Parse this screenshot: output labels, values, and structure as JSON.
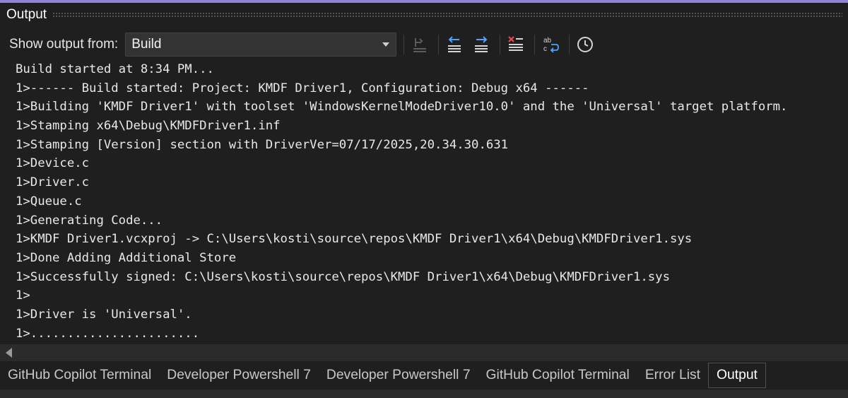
{
  "panel": {
    "title": "Output"
  },
  "toolbar": {
    "show_label": "Show output from:",
    "source_selected": "Build",
    "buttons": [
      {
        "name": "find-message-in-code-icon",
        "enabled": false
      },
      {
        "name": "go-to-previous-message-icon",
        "enabled": true
      },
      {
        "name": "go-to-next-message-icon",
        "enabled": true
      },
      {
        "name": "clear-all-icon",
        "enabled": true
      },
      {
        "name": "toggle-word-wrap-icon",
        "enabled": true
      },
      {
        "name": "toggle-timestamp-icon",
        "enabled": true
      }
    ]
  },
  "output": {
    "lines": [
      "Build started at 8:34 PM...",
      "1>------ Build started: Project: KMDF Driver1, Configuration: Debug x64 ------",
      "1>Building 'KMDF Driver1' with toolset 'WindowsKernelModeDriver10.0' and the 'Universal' target platform.",
      "1>Stamping x64\\Debug\\KMDFDriver1.inf",
      "1>Stamping [Version] section with DriverVer=07/17/2025,20.34.30.631",
      "1>Device.c",
      "1>Driver.c",
      "1>Queue.c",
      "1>Generating Code...",
      "1>KMDF Driver1.vcxproj -> C:\\Users\\kosti\\source\\repos\\KMDF Driver1\\x64\\Debug\\KMDFDriver1.sys",
      "1>Done Adding Additional Store",
      "1>Successfully signed: C:\\Users\\kosti\\source\\repos\\KMDF Driver1\\x64\\Debug\\KMDFDriver1.sys",
      "1>",
      "1>Driver is 'Universal'.",
      "1>......................."
    ]
  },
  "tabs": {
    "items": [
      {
        "label": "GitHub Copilot Terminal",
        "active": false
      },
      {
        "label": "Developer Powershell 7",
        "active": false
      },
      {
        "label": "Developer Powershell 7",
        "active": false
      },
      {
        "label": "GitHub Copilot Terminal",
        "active": false
      },
      {
        "label": "Error List",
        "active": false
      },
      {
        "label": "Output",
        "active": true
      }
    ]
  },
  "colors": {
    "accent": "#9184d0",
    "background": "#1f1f1f",
    "text": "#e8e8e8",
    "icon_blue": "#4da3ff",
    "icon_red": "#f14c4c"
  }
}
